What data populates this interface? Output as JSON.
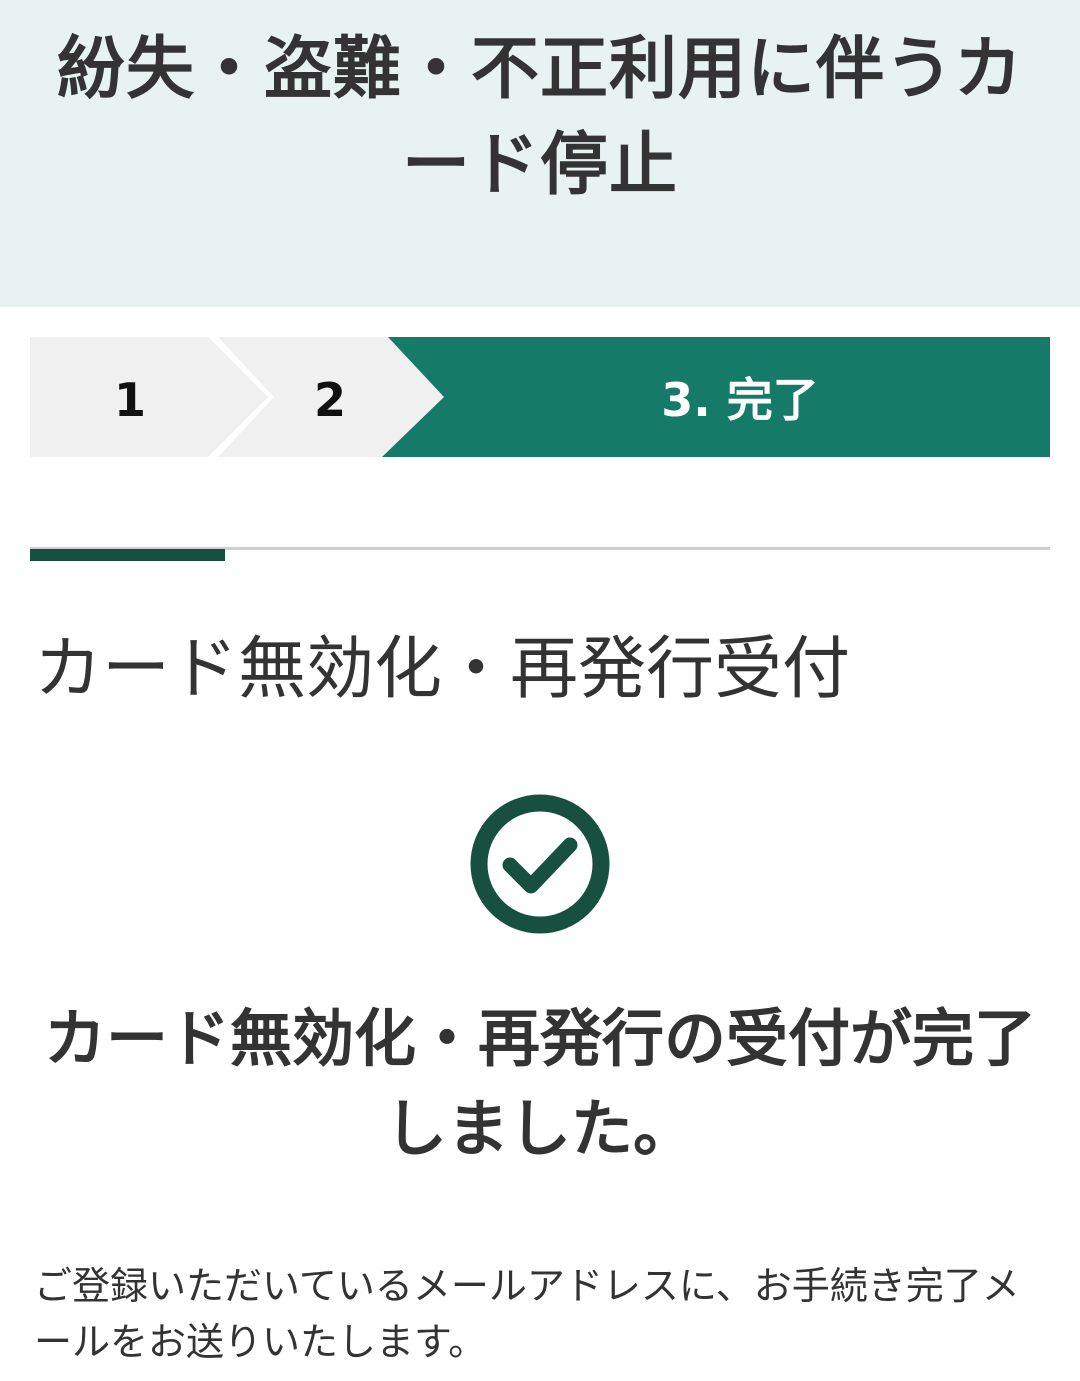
{
  "header": {
    "title": "紛失・盗難・不正利用に伴うカード停止"
  },
  "stepper": {
    "steps": [
      {
        "label": "1",
        "state": "done"
      },
      {
        "label": "2",
        "state": "done"
      },
      {
        "label": "3. 完了",
        "state": "current"
      }
    ],
    "colors": {
      "inactive": "#f0f0f0",
      "active": "#167a69"
    }
  },
  "section": {
    "title": "カード無効化・再発行受付"
  },
  "status": {
    "icon": "check-circle-icon",
    "message": "カード無効化・再発行の受付が完了しました。"
  },
  "note": {
    "text": "ご登録いただいているメールアドレスに、お手続き完了メールをお送りいたします。"
  },
  "colors": {
    "header_bg": "#e8f2f1",
    "accent_dark": "#17503f",
    "accent": "#167a69",
    "text": "#333333"
  }
}
